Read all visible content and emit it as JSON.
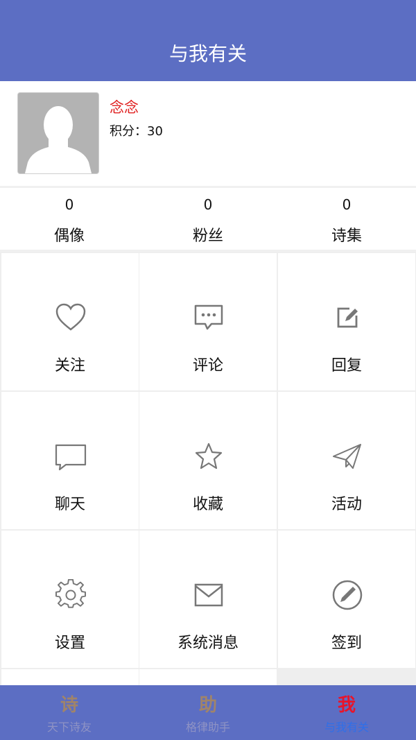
{
  "header": {
    "title": "与我有关"
  },
  "profile": {
    "nickname": "念念",
    "points_label": "积分：30",
    "nickname_color": "#e02020"
  },
  "stats": [
    {
      "value": "0",
      "label": "偶像"
    },
    {
      "value": "0",
      "label": "粉丝"
    },
    {
      "value": "0",
      "label": "诗集"
    }
  ],
  "menu": [
    {
      "label": "关注",
      "icon": "heart-icon"
    },
    {
      "label": "评论",
      "icon": "comment-icon"
    },
    {
      "label": "回复",
      "icon": "edit-icon"
    },
    {
      "label": "聊天",
      "icon": "chat-icon"
    },
    {
      "label": "收藏",
      "icon": "star-icon"
    },
    {
      "label": "活动",
      "icon": "paper-plane-icon"
    },
    {
      "label": "设置",
      "icon": "gear-icon"
    },
    {
      "label": "系统消息",
      "icon": "mail-icon"
    },
    {
      "label": "签到",
      "icon": "pen-circle-icon"
    }
  ],
  "tabbar": {
    "tabs": [
      {
        "glyph": "诗",
        "label": "天下诗友",
        "active": false
      },
      {
        "glyph": "助",
        "label": "格律助手",
        "active": false
      },
      {
        "glyph": "我",
        "label": "与我有关",
        "active": true
      }
    ],
    "inactive_color": "#a0846a",
    "inactive_label_color": "#8f93c4",
    "active_glyph_color": "#e8142a",
    "active_label_color": "#2f6fe8"
  }
}
